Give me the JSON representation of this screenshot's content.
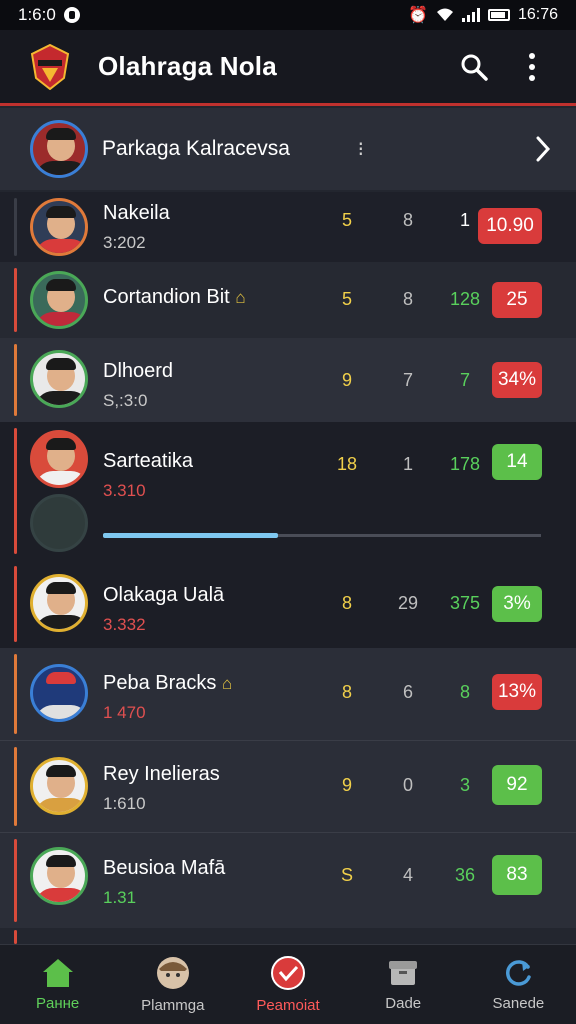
{
  "status_bar": {
    "time": "1:6:0",
    "right_text": "16:76"
  },
  "app_bar": {
    "title": "Olahraga Nola",
    "icons": [
      "search-icon",
      "more-vert-icon"
    ]
  },
  "league": {
    "name": "Parkaga Kalracevsa",
    "dots": "⁝",
    "chevron": "chevron-right-icon"
  },
  "players": [
    {
      "name": "Nakeila",
      "sub": "3:202",
      "sub_color": "#c9c9c9",
      "c1": "5",
      "c2": "8",
      "c3": "1",
      "c3_color": "#ffffff",
      "badge": "10.90",
      "badge_color": "#d93b3b",
      "accent": "#2a2d37",
      "shirt": "#d93b3b"
    },
    {
      "name": "Cortandion Bit",
      "emoji": "🏠",
      "sub": "",
      "c1": "5",
      "c2": "8",
      "c3": "128",
      "c3_color": "#59d05c",
      "badge": "25",
      "badge_color": "#d93b3b",
      "accent": "#d94b3b",
      "shirt": "#c02a3a"
    },
    {
      "name": "Dlhoerd",
      "sub": "S,:3:0",
      "sub_color": "#c9c9c9",
      "c1": "9",
      "c2": "7",
      "c3": "7",
      "c3_color": "#59d05c",
      "badge": "34%",
      "badge_color": "#d93b3b",
      "accent": "#e07a3a",
      "shirt": "#1c1c1c"
    },
    {
      "name": "Sarteatika",
      "sub": "3.310",
      "sub_color": "#e05050",
      "c1": "18",
      "c2": "1",
      "c3": "178",
      "c3_color": "#59d05c",
      "badge": "14",
      "badge_color": "#5cbf4a",
      "accent": "#d94b3b",
      "shirt": "#d93b3b",
      "progress": 0.4
    },
    {
      "name": "Olakaga Ualā",
      "sub": "3.332",
      "sub_color": "#e05050",
      "c1": "8",
      "c2": "29",
      "c3": "375",
      "c3_color": "#59d05c",
      "badge": "3%",
      "badge_color": "#5cbf4a",
      "accent": "#d94b3b",
      "shirt": "#1c1c1c"
    },
    {
      "name": "Peba Bracks",
      "emoji": "🏠",
      "sub": "1 470",
      "sub_color": "#e05050",
      "c1": "8",
      "c2": "6",
      "c3": "8",
      "c3_color": "#59d05c",
      "badge": "13%",
      "badge_color": "#d93b3b",
      "accent": "#e07a3a",
      "shirt": "#1f3a7a"
    },
    {
      "name": "Rey Inelieras",
      "sub": "1:610",
      "sub_color": "#c9c9c9",
      "c1": "9",
      "c2": "0",
      "c3": "3",
      "c3_color": "#59d05c",
      "badge": "92",
      "badge_color": "#5cbf4a",
      "accent": "#e07a3a",
      "shirt": "#d9a040"
    },
    {
      "name": "Beusioa Mafā",
      "sub": "1.31",
      "sub_color": "#59d05c",
      "c1": "S",
      "c2": "4",
      "c3": "36",
      "c3_color": "#59d05c",
      "badge": "83",
      "badge_color": "#5cbf4a",
      "accent": "#d94b3b",
      "shirt": "#d93b3b"
    }
  ],
  "bottom_nav": [
    {
      "label": "Pанне",
      "icon": "home-icon",
      "state": "active"
    },
    {
      "label": "Рlаmmga",
      "icon": "profile-icon",
      "state": "normal"
    },
    {
      "label": "Peamoiat",
      "icon": "check-badge-icon",
      "state": "red"
    },
    {
      "label": "Dade",
      "icon": "box-icon",
      "state": "normal"
    },
    {
      "label": "Sanede",
      "icon": "refresh-icon",
      "state": "normal"
    }
  ]
}
